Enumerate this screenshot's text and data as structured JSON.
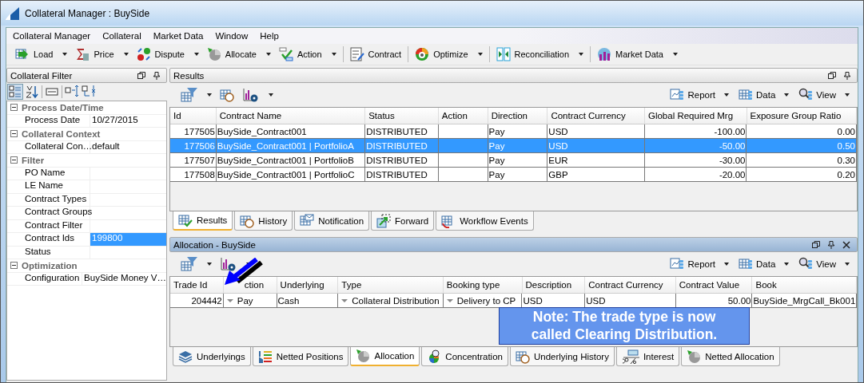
{
  "window": {
    "title": "Collateral Manager : BuySide"
  },
  "menu": [
    "Collateral Manager",
    "Collateral",
    "Market Data",
    "Window",
    "Help"
  ],
  "toolbar": [
    {
      "label": "Load",
      "dropdown": true
    },
    {
      "label": "Price",
      "dropdown": true
    },
    {
      "label": "Dispute",
      "dropdown": true
    },
    {
      "label": "Allocate",
      "dropdown": true
    },
    {
      "label": "Action",
      "dropdown": true
    },
    {
      "label": "Contract",
      "dropdown": false
    },
    {
      "label": "Optimize",
      "dropdown": true
    },
    {
      "label": "Reconciliation",
      "dropdown": true
    },
    {
      "label": "Market Data",
      "dropdown": true
    }
  ],
  "filter_panel": {
    "title": "Collateral Filter",
    "sections": [
      {
        "name": "Process Date/Time",
        "expanded": true,
        "rows": [
          {
            "label": "Process Date",
            "value": "10/27/2015",
            "selected": false
          }
        ]
      },
      {
        "name": "Collateral Context",
        "expanded": true,
        "rows": [
          {
            "label": "Collateral Con…",
            "value": "default",
            "selected": false
          }
        ]
      },
      {
        "name": "Filter",
        "expanded": true,
        "rows": [
          {
            "label": "PO Name",
            "selected": false
          },
          {
            "label": "LE Name",
            "selected": false
          },
          {
            "label": "Contract Types",
            "selected": false
          },
          {
            "label": "Contract Groups",
            "selected": false
          },
          {
            "label": "Contract Filter",
            "selected": false
          },
          {
            "label": "Contract Ids",
            "value": "199800",
            "selected": true
          },
          {
            "label": "Status",
            "selected": false
          }
        ]
      },
      {
        "name": "Optimization",
        "expanded": true,
        "rows": [
          {
            "label": "Configuration",
            "value": "BuySide Money V…",
            "selected": false
          }
        ]
      }
    ]
  },
  "results_panel": {
    "title": "Results",
    "actions": [
      "Report",
      "Data",
      "View"
    ],
    "table": {
      "columns": [
        {
          "label": "Id",
          "kind": "number"
        },
        {
          "label": "Contract Name",
          "kind": "text"
        },
        {
          "label": "Status",
          "kind": "text"
        },
        {
          "label": "Action",
          "kind": "text"
        },
        {
          "label": "Direction",
          "kind": "text"
        },
        {
          "label": "Contract Currency",
          "kind": "text"
        },
        {
          "label": "Global Required Mrg",
          "kind": "number"
        },
        {
          "label": "Exposure Group Ratio",
          "kind": "number"
        }
      ],
      "rows": [
        {
          "selected": false,
          "cells": [
            "177505",
            "BuySide_Contract001",
            "DISTRIBUTED",
            "",
            "Pay",
            "USD",
            "-100.00",
            "0.00"
          ]
        },
        {
          "selected": true,
          "cells": [
            "177506",
            "BuySide_Contract001 | PortfolioA",
            "DISTRIBUTED",
            "",
            "Pay",
            "USD",
            "-50.00",
            "0.50"
          ]
        },
        {
          "selected": false,
          "cells": [
            "177507",
            "BuySide_Contract001 | PortfolioB",
            "DISTRIBUTED",
            "",
            "Pay",
            "EUR",
            "-30.00",
            "0.30"
          ]
        },
        {
          "selected": false,
          "cells": [
            "177508",
            "BuySide_Contract001 | PortfolioC",
            "DISTRIBUTED",
            "",
            "Pay",
            "GBP",
            "-20.00",
            "0.20"
          ]
        }
      ]
    },
    "tabs": [
      {
        "label": "Results",
        "selected": true
      },
      {
        "label": "History",
        "selected": false
      },
      {
        "label": "Notification",
        "selected": false
      },
      {
        "label": "Forward",
        "selected": false
      },
      {
        "label": "Workflow Events",
        "selected": false
      }
    ]
  },
  "allocation_panel": {
    "title": "Allocation - BuySide",
    "actions": [
      "Report",
      "Data",
      "View"
    ],
    "table": {
      "columns": [
        {
          "label": "Trade Id"
        },
        {
          "label": "ction"
        },
        {
          "label": "Underlying"
        },
        {
          "label": "Type"
        },
        {
          "label": "Booking type"
        },
        {
          "label": "Description"
        },
        {
          "label": "Contract Currency"
        },
        {
          "label": "Contract Value"
        },
        {
          "label": "Book"
        }
      ],
      "rows": [
        {
          "selected": false,
          "cells": [
            {
              "text": "204442",
              "kind": "number",
              "dropdown": false
            },
            {
              "text": "Pay",
              "kind": "text",
              "dropdown": true
            },
            {
              "text": "Cash",
              "kind": "text",
              "dropdown": false
            },
            {
              "text": "Collateral Distribution",
              "kind": "text",
              "dropdown": true
            },
            {
              "text": "Delivery to CP",
              "kind": "text",
              "dropdown": true
            },
            {
              "text": "USD",
              "kind": "text",
              "dropdown": false
            },
            {
              "text": "USD",
              "kind": "text",
              "dropdown": false
            },
            {
              "text": "50.00",
              "kind": "number",
              "dropdown": false
            },
            {
              "text": "BuySide_MrgCall_Bk001",
              "kind": "text",
              "dropdown": false
            }
          ]
        }
      ]
    },
    "note": "Note: The trade type is now called Clearing Distribution.",
    "tabs": [
      {
        "label": "Underlyings",
        "selected": false
      },
      {
        "label": "Netted Positions",
        "selected": false
      },
      {
        "label": "Allocation",
        "selected": true
      },
      {
        "label": "Concentration",
        "selected": false
      },
      {
        "label": "Underlying History",
        "selected": false
      },
      {
        "label": "Interest",
        "selected": false
      },
      {
        "label": "Netted Allocation",
        "selected": false
      }
    ]
  }
}
